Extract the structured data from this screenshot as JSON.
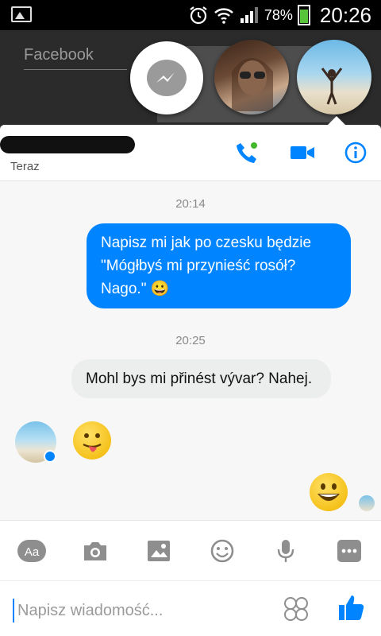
{
  "status_bar": {
    "battery_percent": "78%",
    "time": "20:26"
  },
  "background_app": {
    "field_label": "Facebook"
  },
  "header": {
    "status": "Teraz"
  },
  "messages": {
    "timestamp_1": "20:14",
    "outgoing_1": "Napisz mi jak po czesku będzie \"Mógłbyś mi przynieść rosół? Nago.\" 😀",
    "timestamp_2": "20:25",
    "incoming_1": "Mohl bys mi přinést vývar? Nahej."
  },
  "composer": {
    "placeholder": "Napisz wiadomość..."
  },
  "colors": {
    "accent": "#0084ff",
    "incoming_bubble": "#eceded",
    "chat_bg": "#f7f7f7"
  }
}
